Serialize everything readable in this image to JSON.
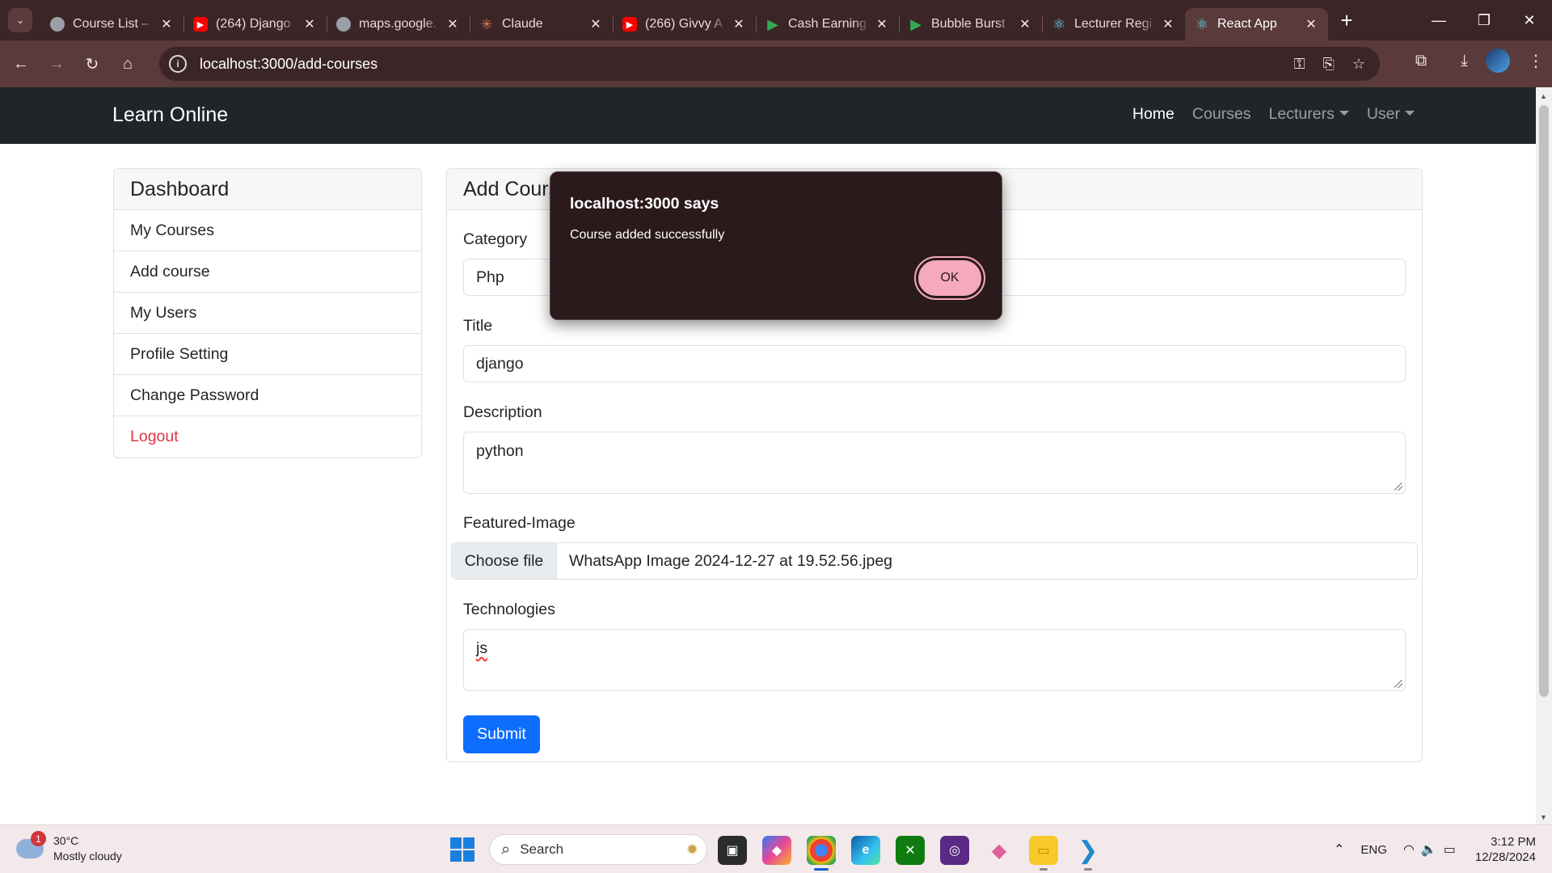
{
  "browser": {
    "tabs": [
      {
        "title": "Course List –",
        "favicon_color": "#9aa0a6",
        "active": false
      },
      {
        "title": "(264) Django",
        "favicon_color": "#ff0000",
        "active": false
      },
      {
        "title": "maps.google.",
        "favicon_color": "#9aa0a6",
        "active": false
      },
      {
        "title": "Claude",
        "favicon_color": "#d97757",
        "active": false
      },
      {
        "title": "(266) Givvy A",
        "favicon_color": "#ff0000",
        "active": false
      },
      {
        "title": "Cash Earning",
        "favicon_color": "#2e7df6",
        "active": false
      },
      {
        "title": "Bubble Burst",
        "favicon_color": "#2e7df6",
        "active": false
      },
      {
        "title": "Lecturer Regi",
        "favicon_color": "#61dafb",
        "active": false
      },
      {
        "title": "React App",
        "favicon_color": "#61dafb",
        "active": true
      }
    ],
    "url": "localhost:3000/add-courses"
  },
  "navbar": {
    "brand": "Learn Online",
    "links": {
      "home": "Home",
      "courses": "Courses",
      "lecturers": "Lecturers",
      "user": "User"
    }
  },
  "sidebar": {
    "title": "Dashboard",
    "items": [
      "My Courses",
      "Add course",
      "My Users",
      "Profile Setting",
      "Change Password",
      "Logout"
    ]
  },
  "form": {
    "title": "Add Course",
    "category_label": "Category",
    "category_value": "Php",
    "title_label": "Title",
    "title_value": "django",
    "description_label": "Description",
    "description_value": "python",
    "image_label": "Featured-Image",
    "choose_file": "Choose file",
    "file_name": "WhatsApp Image 2024-12-27 at 19.52.56.jpeg",
    "technologies_label": "Technologies",
    "technologies_value": "js",
    "submit": "Submit"
  },
  "alert": {
    "title": "localhost:3000 says",
    "message": "Course added successfully",
    "ok": "OK"
  },
  "taskbar": {
    "weather_temp": "30°C",
    "weather_desc": "Mostly cloudy",
    "weather_badge": "1",
    "search_placeholder": "Search",
    "language": "ENG",
    "time": "3:12 PM",
    "date": "12/28/2024"
  },
  "colors": {
    "accent": "#0d6efd",
    "logout": "#dc3545",
    "navbar_bg": "#212529",
    "chrome_bg": "#5a3a3b",
    "dialog_ok": "#f5a9bf"
  }
}
